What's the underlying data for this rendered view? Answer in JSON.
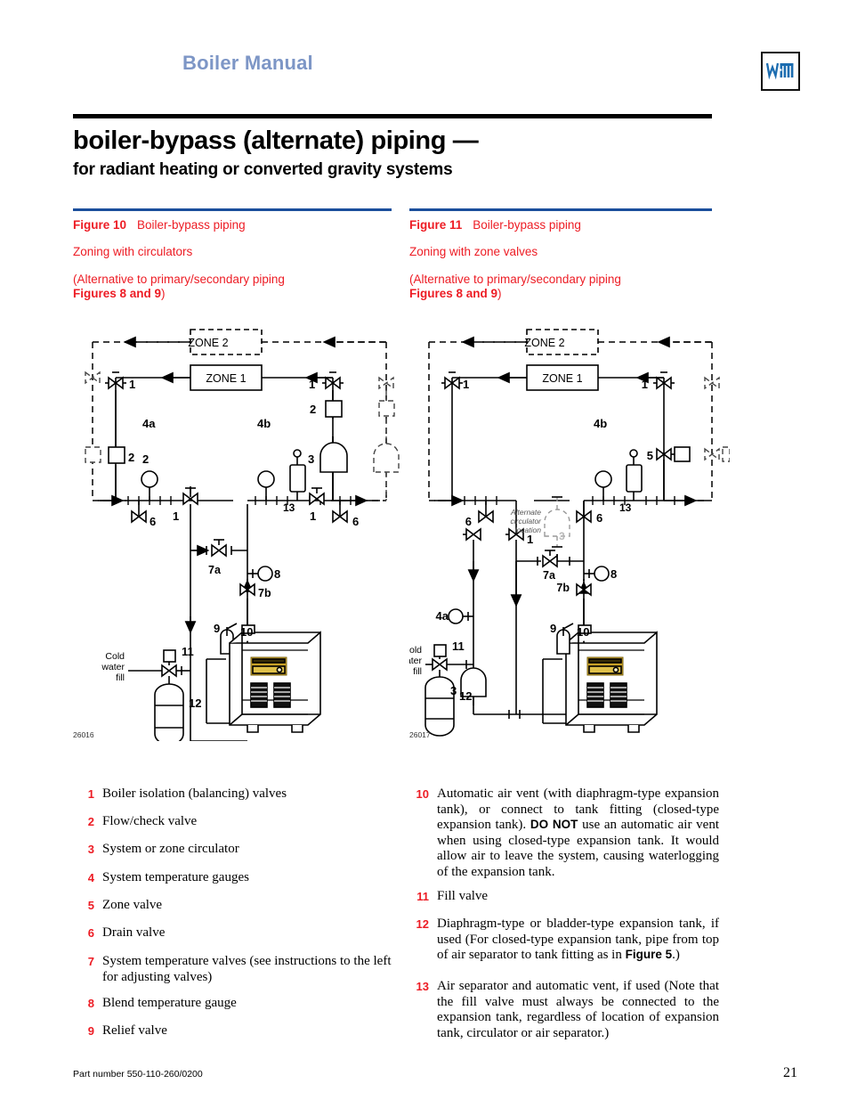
{
  "header": {
    "manual_title": "Boiler Manual",
    "logo_alt": "weil-mclain-logo"
  },
  "title": {
    "line1": "boiler-bypass (alternate) piping —",
    "line2": "for radiant heating or converted gravity systems"
  },
  "figures": [
    {
      "label": "Figure 10",
      "caption": "Boiler-bypass piping",
      "subtitle": " Zoning with circulators",
      "note_line1": "(Alternative to primary/secondary piping",
      "note_bold": "Figures 8 and 9",
      "note_tail": ")",
      "drawing_number": "26016",
      "zone2": "ZONE 2",
      "zone1": "ZONE 1",
      "cold_water_fill": [
        "Cold",
        "water",
        "fill"
      ],
      "callouts": [
        "1",
        "2",
        "3",
        "4a",
        "4b",
        "6",
        "7a",
        "7b",
        "8",
        "9",
        "10",
        "11",
        "12",
        "13"
      ]
    },
    {
      "label": "Figure 11",
      "caption": "Boiler-bypass piping",
      "subtitle": "Zoning with zone valves",
      "note_line1": "(Alternative to primary/secondary piping",
      "note_bold": "Figures 8 and 9",
      "note_tail": ")",
      "drawing_number": "26017",
      "zone2": "ZONE 2",
      "zone1": "ZONE 1",
      "cold_water_fill": [
        "Cold",
        "water",
        "fill"
      ],
      "alternate_circulator": [
        "Alternate",
        "circulator",
        "location"
      ],
      "callouts": [
        "1",
        "3",
        "4a",
        "4b",
        "5",
        "6",
        "7a",
        "7b",
        "8",
        "9",
        "10",
        "11",
        "12",
        "13"
      ]
    }
  ],
  "legend_left": [
    {
      "num": "1",
      "text": "Boiler isolation (balancing) valves"
    },
    {
      "num": "2",
      "text": "Flow/check valve"
    },
    {
      "num": "3",
      "text": "System or zone circulator"
    },
    {
      "num": "4",
      "text": "System temperature gauges"
    },
    {
      "num": "5",
      "text": "Zone valve"
    },
    {
      "num": "6",
      "text": "Drain valve"
    },
    {
      "num": "7",
      "text": "System temperature valves (see instructions to the left for adjusting valves)"
    },
    {
      "num": "8",
      "text": "Blend temperature gauge"
    },
    {
      "num": "9",
      "text": "Relief valve"
    }
  ],
  "legend_right": [
    {
      "num": "10",
      "parts": [
        {
          "t": "Automatic air vent (with diaphragm-type expansion tank), or connect to tank fitting (closed-type expansion tank). ",
          "style": "normal"
        },
        {
          "t": "DO NOT",
          "style": "bold-sans"
        },
        {
          "t": " use an automatic air vent when using closed-type expansion tank. It would allow air to leave the system, causing waterlogging of the expansion tank.",
          "style": "normal"
        }
      ]
    },
    {
      "num": "11",
      "parts": [
        {
          "t": "Fill valve",
          "style": "normal"
        }
      ]
    },
    {
      "num": "12",
      "parts": [
        {
          "t": "Diaphragm-type or bladder-type expansion tank, if used (For closed-type expansion tank, pipe from top of air separator to tank fitting as in ",
          "style": "normal"
        },
        {
          "t": "Figure 5",
          "style": "bold-sans"
        },
        {
          "t": ".)",
          "style": "normal"
        }
      ]
    },
    {
      "num": "13",
      "parts": [
        {
          "t": "Air separator and automatic vent, if used (Note that the fill valve must always be connected to the expansion tank, regardless of location of expansion tank, circulator or air separator.)",
          "style": "normal"
        }
      ]
    }
  ],
  "footer": {
    "part_number": "Part number 550-110-260/0200",
    "page_number": "21"
  },
  "colors": {
    "header_blue": "#7d96c6",
    "rule_blue": "#1b4f9c",
    "caption_red": "#ed1c24",
    "logo_blue": "#1b6cb0"
  }
}
